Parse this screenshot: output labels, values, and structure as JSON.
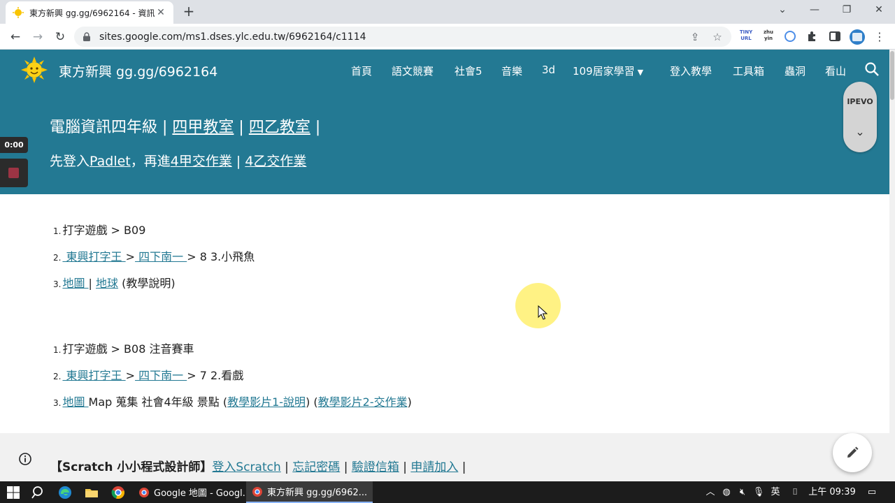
{
  "browser": {
    "tab_title": "東方新興 gg.gg/6962164 - 資訊",
    "tab_close": "✕",
    "new_tab": "+",
    "url": "sites.google.com/ms1.dses.ylc.edu.tw/6962164/c1114",
    "ext_tinyurl": "TINY URL",
    "ext_zhuyin": "zhu yin"
  },
  "site": {
    "title": "東方新興 gg.gg/6962164",
    "nav": [
      "首頁",
      "語文競賽",
      "社會5",
      "音樂",
      "3d",
      "109居家學習",
      "登入教學",
      "工具箱",
      "蟲洞",
      "看山"
    ],
    "hero": {
      "line1_a": "電腦資訊四年級 | ",
      "line1_link1": "四甲教室",
      "line1_b": " | ",
      "line1_link2": "四乙教室",
      "line1_c": " |",
      "line2_a": "先登入",
      "line2_link1": "Padlet",
      "line2_b": "，再進",
      "line2_link2": "4甲交作業",
      "line2_c": " | ",
      "line2_link3": "4乙交作業"
    }
  },
  "widgets": {
    "ipevo_label": "IPEVO",
    "rec_time": "0:00"
  },
  "content": {
    "list1": {
      "item1_num": "1.",
      "item1_text": "打字遊戲 > B09",
      "item2_num": "2.",
      "item2_link1": " 東興打字王 ",
      "item2_sep": ">",
      "item2_link2": " 四下南一 ",
      "item2_text": " > 8 3.小飛魚",
      "item3_num": "3.",
      "item3_link1": "地圖 ",
      "item3_sep": " | ",
      "item3_link2": "地球",
      "item3_text": " (教學說明)"
    },
    "list2": {
      "item1_num": "1.",
      "item1_text": "打字遊戲 > B08 注音賽車",
      "item2_num": "2.",
      "item2_link1": " 東興打字王 ",
      "item2_sep": ">",
      "item2_link2": " 四下南一 ",
      "item2_text": " > 7 2.看戲",
      "item3_num": "3.",
      "item3_link1": "地圖 ",
      "item3_text_a": " Map 蒐集 社會4年級 景點 (",
      "item3_link2": "教學影片1-說明",
      "item3_text_b": ") (",
      "item3_link3": "教學影片2-交作業",
      "item3_text_c": ")"
    },
    "footer": {
      "bold": "【Scratch 小小程式設計師】",
      "link1": "登入Scratch",
      "sep": " | ",
      "link2": "忘記密碼",
      "link3": "驗證信箱",
      "link4": "申請加入",
      "end": " |"
    }
  },
  "taskbar": {
    "app1": "Google 地圖 - Googl...",
    "app2": "東方新興 gg.gg/6962...",
    "ime": "英",
    "time": "上午 09:39"
  }
}
